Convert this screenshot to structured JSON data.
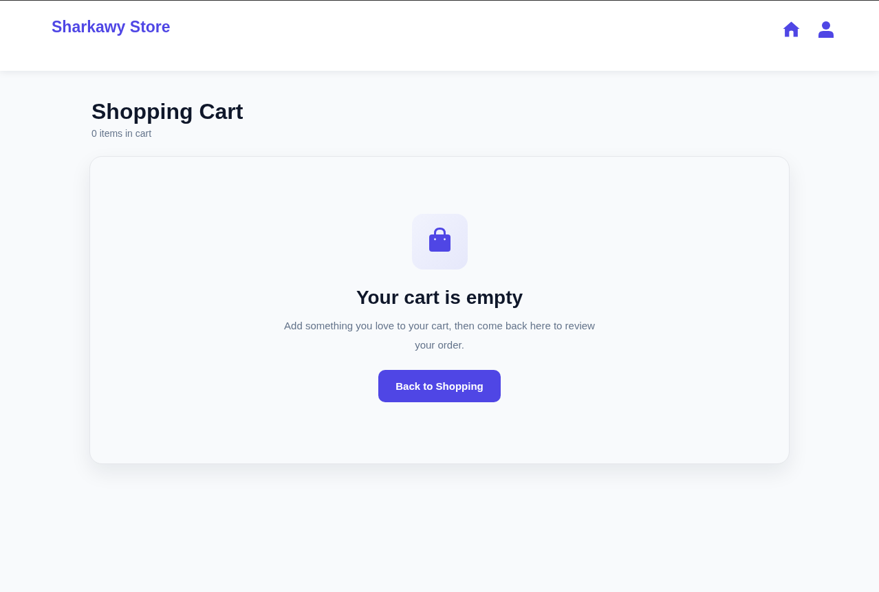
{
  "header": {
    "brand": "Sharkawy Store"
  },
  "page": {
    "title": "Shopping Cart",
    "subtitle": "0 items in cart"
  },
  "empty_state": {
    "heading": "Your cart is empty",
    "message": "Add something you love to your cart, then come back here to review your order.",
    "button": "Back to Shopping"
  }
}
